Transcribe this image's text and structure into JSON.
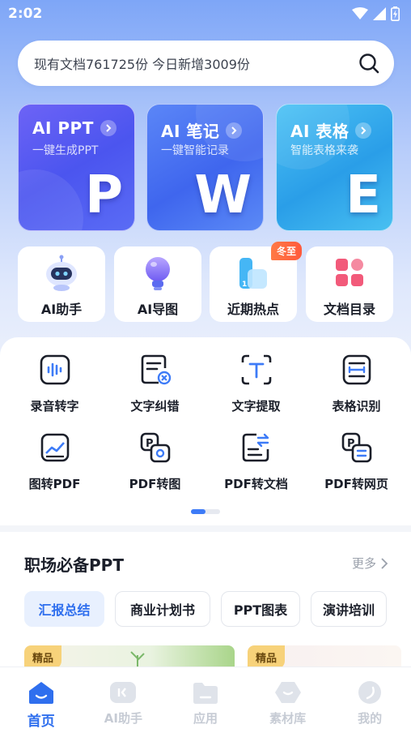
{
  "status_bar": {
    "time": "2:02"
  },
  "search": {
    "placeholder": "现有文档761725份 今日新增3009份"
  },
  "feature_cards": [
    {
      "title": "AI PPT",
      "subtitle": "一键生成PPT",
      "letter": "P"
    },
    {
      "title": "AI 笔记",
      "subtitle": "一键智能记录",
      "letter": "W"
    },
    {
      "title": "AI 表格",
      "subtitle": "智能表格来袭",
      "letter": "E"
    }
  ],
  "quick_tiles": [
    {
      "label": "AI助手"
    },
    {
      "label": "AI导图"
    },
    {
      "label": "近期热点",
      "badge": "冬至"
    },
    {
      "label": "文档目录"
    }
  ],
  "tools": [
    {
      "label": "录音转字",
      "icon": "audio-wave-icon"
    },
    {
      "label": "文字纠错",
      "icon": "doc-correct-icon"
    },
    {
      "label": "文字提取",
      "icon": "text-extract-icon"
    },
    {
      "label": "表格识别",
      "icon": "table-scan-icon"
    },
    {
      "label": "图转PDF",
      "icon": "image-to-pdf-icon"
    },
    {
      "label": "PDF转图",
      "icon": "pdf-to-image-icon"
    },
    {
      "label": "PDF转文档",
      "icon": "pdf-to-doc-icon"
    },
    {
      "label": "PDF转网页",
      "icon": "pdf-to-web-icon"
    }
  ],
  "section": {
    "title": "职场必备PPT",
    "more": "更多",
    "chips": [
      "汇报总结",
      "商业计划书",
      "PPT图表",
      "演讲培训"
    ],
    "thumb_badges": [
      "精品",
      "精品"
    ]
  },
  "bottom_nav": [
    {
      "label": "首页"
    },
    {
      "label": "AI助手"
    },
    {
      "label": "应用"
    },
    {
      "label": "素材库"
    },
    {
      "label": "我的"
    }
  ],
  "colors": {
    "accent": "#2f6fee",
    "badge": "#ff5a3c",
    "card_ppt": "#5a5df2",
    "card_word": "#4a74f0",
    "card_excel": "#36b0ee"
  }
}
